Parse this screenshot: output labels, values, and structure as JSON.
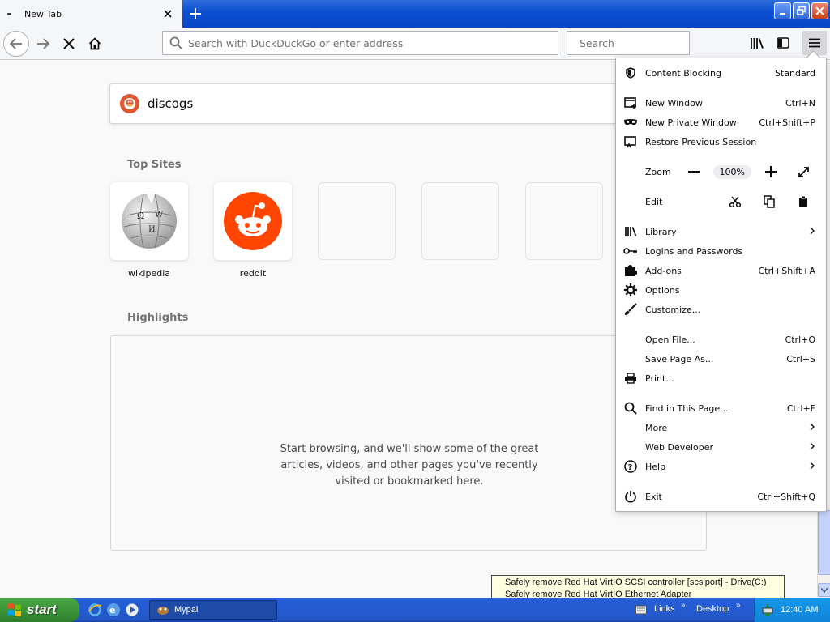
{
  "window": {
    "tab_title": "New Tab"
  },
  "navbar": {
    "url_placeholder": "Search with DuckDuckGo or enter address",
    "search_placeholder": "Search"
  },
  "newtab": {
    "search_value": "discogs",
    "top_sites_title": "Top Sites",
    "top_sites": [
      {
        "label": "wikipedia"
      },
      {
        "label": "reddit"
      },
      {
        "label": ""
      },
      {
        "label": ""
      },
      {
        "label": ""
      }
    ],
    "highlights_title": "Highlights",
    "highlights_message": "Start browsing, and we'll show some of the great articles, videos, and other pages you've recently visited or bookmarked here."
  },
  "app_menu": {
    "content_blocking": {
      "label": "Content Blocking",
      "value": "Standard"
    },
    "new_window": {
      "label": "New Window",
      "shortcut": "Ctrl+N"
    },
    "new_private_window": {
      "label": "New Private Window",
      "shortcut": "Ctrl+Shift+P"
    },
    "restore_session": {
      "label": "Restore Previous Session"
    },
    "zoom": {
      "label": "Zoom",
      "value": "100%"
    },
    "edit": {
      "label": "Edit"
    },
    "library": {
      "label": "Library"
    },
    "logins": {
      "label": "Logins and Passwords"
    },
    "addons": {
      "label": "Add-ons",
      "shortcut": "Ctrl+Shift+A"
    },
    "options": {
      "label": "Options"
    },
    "customize": {
      "label": "Customize..."
    },
    "open_file": {
      "label": "Open File...",
      "shortcut": "Ctrl+O"
    },
    "save_page": {
      "label": "Save Page As...",
      "shortcut": "Ctrl+S"
    },
    "print": {
      "label": "Print..."
    },
    "find": {
      "label": "Find in This Page...",
      "shortcut": "Ctrl+F"
    },
    "more": {
      "label": "More"
    },
    "web_developer": {
      "label": "Web Developer"
    },
    "help": {
      "label": "Help"
    },
    "exit": {
      "label": "Exit",
      "shortcut": "Ctrl+Shift+Q"
    }
  },
  "tray_balloon": {
    "line1": "Safely remove Red Hat VirtIO SCSI controller [scsiport] - Drive(C:)",
    "line2": "Safely remove Red Hat VirtIO Ethernet Adapter"
  },
  "taskbar": {
    "start_label": "start",
    "task_label": "Mypal",
    "links_label": "Links",
    "desktop_label": "Desktop",
    "clock": "12:40 AM"
  }
}
